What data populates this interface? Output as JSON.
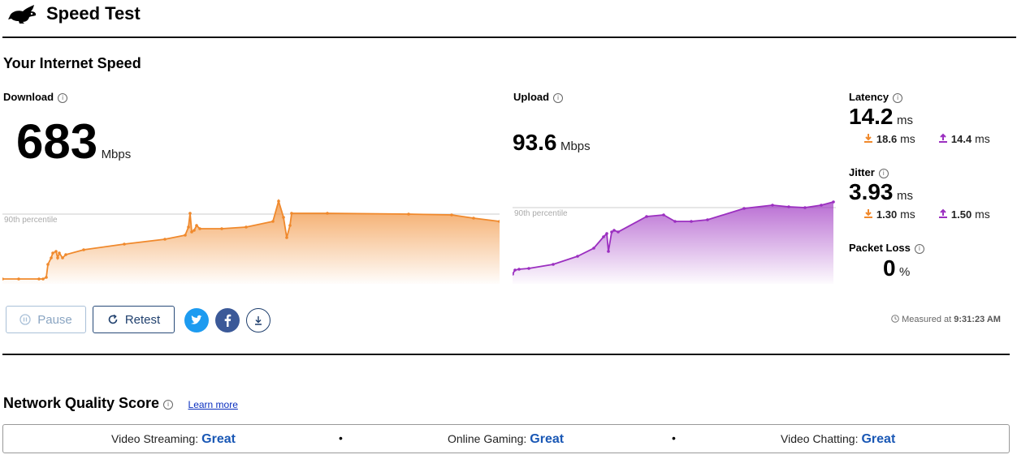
{
  "app": {
    "title": "Speed Test"
  },
  "section": {
    "title": "Your Internet Speed"
  },
  "download": {
    "label": "Download",
    "value": "683",
    "unit": "Mbps",
    "percentile_label": "90th percentile",
    "color": "#f0892c"
  },
  "upload": {
    "label": "Upload",
    "value": "93.6",
    "unit": "Mbps",
    "percentile_label": "90th percentile",
    "color": "#9b2fc0"
  },
  "latency": {
    "label": "Latency",
    "value": "14.2",
    "unit": "ms",
    "down_value": "18.6",
    "down_unit": "ms",
    "up_value": "14.4",
    "up_unit": "ms"
  },
  "jitter": {
    "label": "Jitter",
    "value": "3.93",
    "unit": "ms",
    "down_value": "1.30",
    "down_unit": "ms",
    "up_value": "1.50",
    "up_unit": "ms"
  },
  "packet_loss": {
    "label": "Packet Loss",
    "value": "0",
    "unit": "%"
  },
  "controls": {
    "pause_label": "Pause",
    "retest_label": "Retest"
  },
  "share": {
    "twitter_color": "#1d9bf0",
    "facebook_color": "#3b5998"
  },
  "measured": {
    "prefix": "Measured at",
    "time": "9:31:23 AM"
  },
  "network_quality": {
    "title": "Network Quality Score",
    "learn_more": "Learn more",
    "items": [
      {
        "label": "Video Streaming:",
        "value": "Great"
      },
      {
        "label": "Online Gaming:",
        "value": "Great"
      },
      {
        "label": "Video Chatting:",
        "value": "Great"
      }
    ],
    "separator": "•"
  },
  "icons": [
    "rabbit-logo-icon",
    "info-icon",
    "pause-icon",
    "retest-icon",
    "twitter-icon",
    "facebook-icon",
    "download-icon",
    "clock-icon",
    "download-arrow-icon",
    "upload-arrow-icon"
  ]
}
